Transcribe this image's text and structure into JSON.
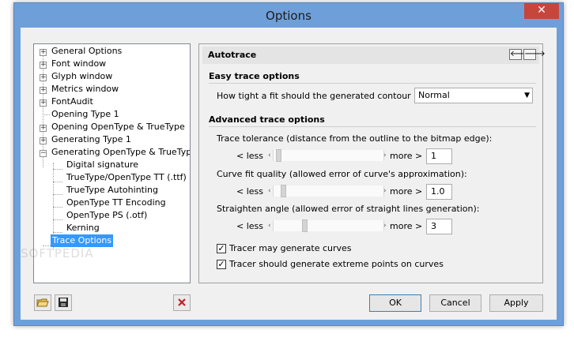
{
  "window": {
    "title": "Options",
    "close_glyph": "✕"
  },
  "tree": {
    "items": [
      {
        "label": "General Options",
        "expander": "+"
      },
      {
        "label": "Font window",
        "expander": "+"
      },
      {
        "label": "Glyph window",
        "expander": "+"
      },
      {
        "label": "Metrics window",
        "expander": "+"
      },
      {
        "label": "FontAudit",
        "expander": "+"
      },
      {
        "label": "Opening Type 1",
        "expander": ""
      },
      {
        "label": "Opening OpenType & TrueType",
        "expander": "+"
      },
      {
        "label": "Generating Type 1",
        "expander": "+"
      },
      {
        "label": "Generating OpenType & TrueType",
        "expander": "−"
      },
      {
        "label": "Digital signature",
        "expander": ""
      },
      {
        "label": "TrueType/OpenType TT (.ttf)",
        "expander": ""
      },
      {
        "label": "TrueType Autohinting",
        "expander": ""
      },
      {
        "label": "OpenType TT Encoding",
        "expander": ""
      },
      {
        "label": "OpenType PS (.otf)",
        "expander": ""
      },
      {
        "label": "Kerning",
        "expander": ""
      },
      {
        "label": "Trace Options",
        "expander": ""
      }
    ],
    "selected": "Trace Options"
  },
  "panel": {
    "title": "Autotrace",
    "back_glyph": "🡐",
    "forward_glyph": "🡒",
    "easy_section": "Easy trace options",
    "fit_question": "How tight a fit should the generated contour be?",
    "fit_value": "Normal",
    "advanced_section": "Advanced trace options",
    "sliders": [
      {
        "label": "Trace tolerance (distance from the outline to the bitmap edge):",
        "less": "< less",
        "more": "more >",
        "value": "1",
        "level": 0.02
      },
      {
        "label": "Curve fit quality (allowed error of curve's approximation):",
        "less": "< less",
        "more": "more >",
        "value": "1.0",
        "level": 0.07
      },
      {
        "label": "Straighten angle (allowed error of straight lines generation):",
        "less": "< less",
        "more": "more >",
        "value": "3",
        "level": 0.27
      }
    ],
    "checkboxes": [
      {
        "label": "Tracer may generate curves",
        "checked": true
      },
      {
        "label": "Tracer should generate extreme points on curves",
        "checked": true
      }
    ]
  },
  "buttons": {
    "ok": "OK",
    "cancel": "Cancel",
    "apply": "Apply"
  },
  "watermark": "SOFTPEDIA"
}
